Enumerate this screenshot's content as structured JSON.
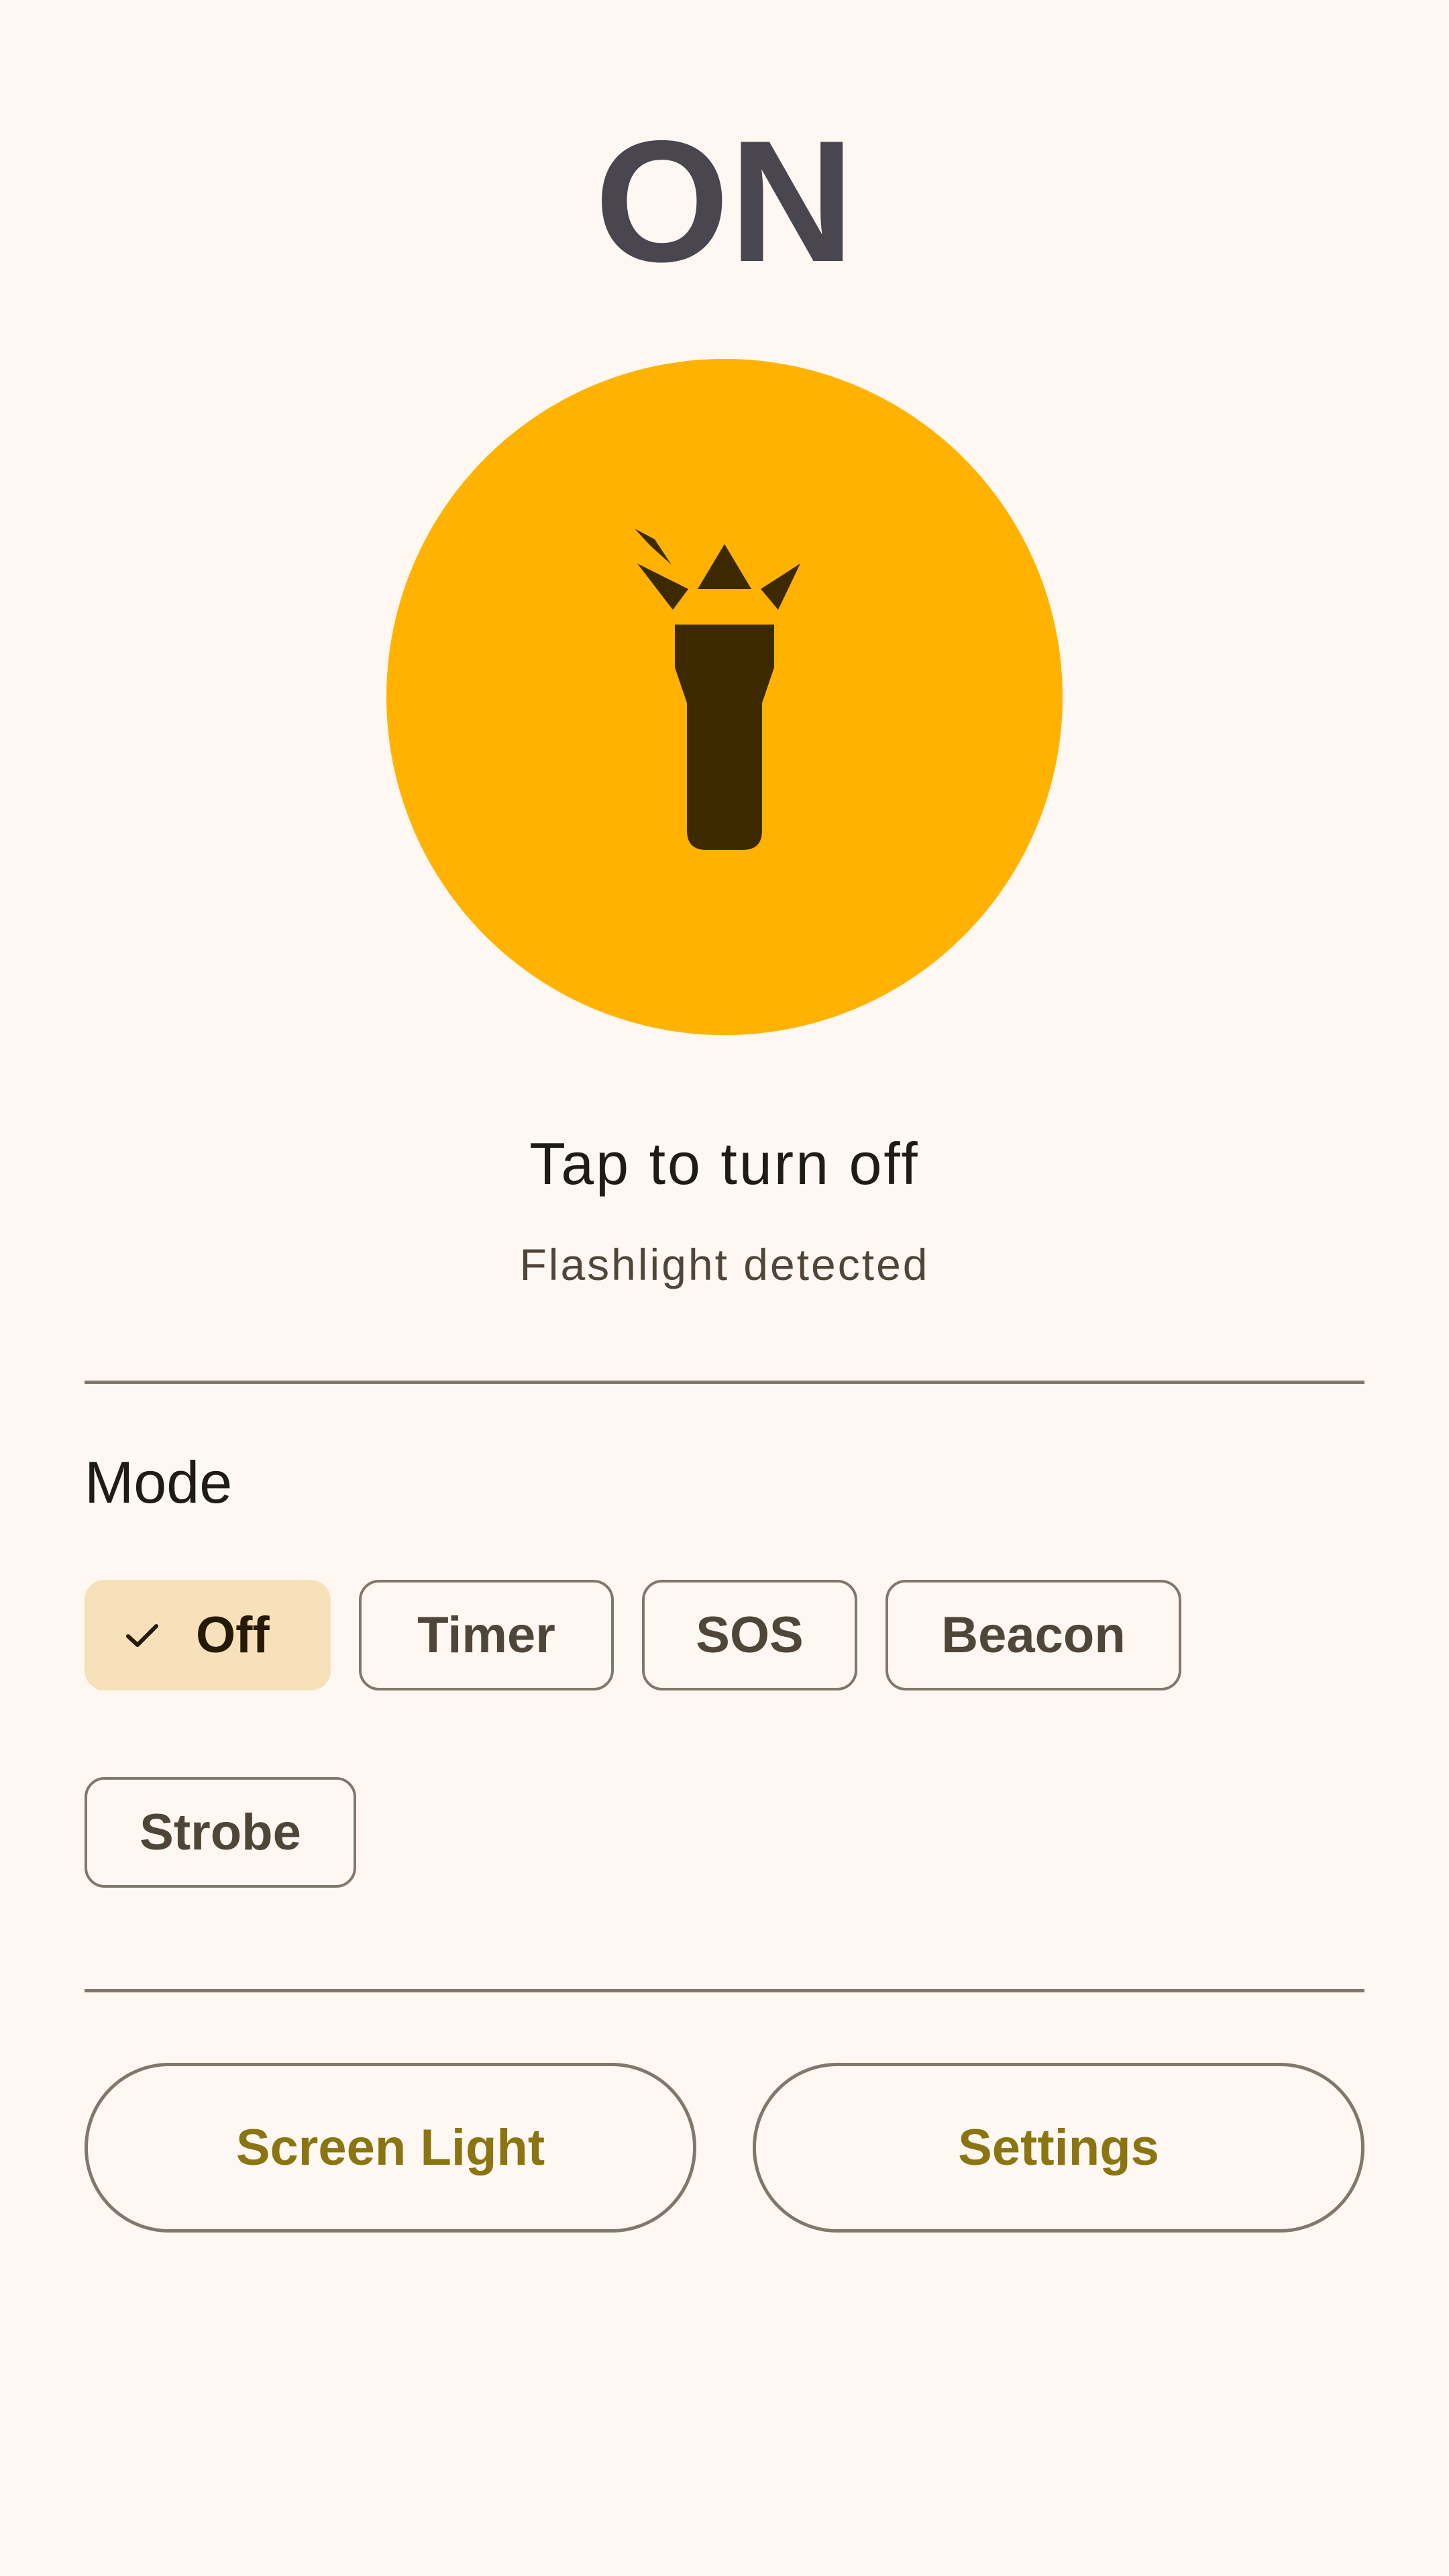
{
  "status": {
    "title": "ON"
  },
  "torch": {
    "icon": "flashlight-icon",
    "accent_color": "#ffb300",
    "icon_color": "#3d2900"
  },
  "hints": {
    "primary": "Tap to turn off",
    "secondary": "Flashlight detected"
  },
  "mode": {
    "title": "Mode",
    "selected": "Off",
    "check_icon": "check-icon",
    "chips": [
      {
        "label": "Off"
      },
      {
        "label": "Timer"
      },
      {
        "label": "SOS"
      },
      {
        "label": "Beacon"
      },
      {
        "label": "Strobe"
      }
    ]
  },
  "actions": {
    "screen_light_label": "Screen Light",
    "settings_label": "Settings"
  },
  "colors": {
    "background": "#fff8f2",
    "selected_chip": "#f6e1bb",
    "outline": "#81776b",
    "action_text": "#8a7512"
  }
}
